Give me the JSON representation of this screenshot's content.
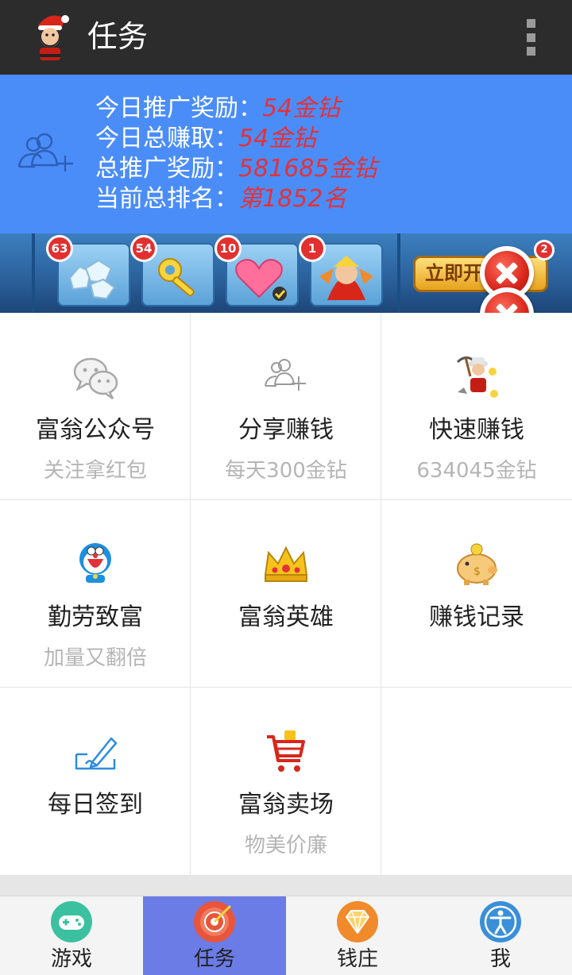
{
  "appbar": {
    "title": "任务",
    "avatar_icon": "santa-avatar-icon",
    "menu_icon": "overflow-menu-icon"
  },
  "stats": {
    "icon": "add-friends-icon",
    "lines": [
      {
        "label": "今日推广奖励：",
        "value": "54金钻"
      },
      {
        "label": "今日总赚取：",
        "value": "54金钻"
      },
      {
        "label": "总推广奖励：",
        "value": "581685金钻"
      },
      {
        "label": "当前总排名：",
        "value": "第1852名"
      }
    ]
  },
  "banner": {
    "badges": [
      "63",
      "54",
      "10",
      "1"
    ],
    "cta_text": "立即开",
    "cta_badge": "2"
  },
  "grid": [
    {
      "name": "富翁公众号",
      "sub": "关注拿红包",
      "icon": "wechat-icon"
    },
    {
      "name": "分享赚钱",
      "sub": "每天300金钻",
      "icon": "share-people-icon"
    },
    {
      "name": "快速赚钱",
      "sub": "634045金钻",
      "icon": "miner-icon"
    },
    {
      "name": "勤劳致富",
      "sub": "加量又翻倍",
      "icon": "doraemon-icon"
    },
    {
      "name": "富翁英雄",
      "sub": "",
      "icon": "crown-icon"
    },
    {
      "name": "赚钱记录",
      "sub": "",
      "icon": "piggy-bank-icon"
    },
    {
      "name": "每日签到",
      "sub": "",
      "icon": "sign-in-icon"
    },
    {
      "name": "富翁卖场",
      "sub": "物美价廉",
      "icon": "shopping-cart-icon"
    }
  ],
  "bottom_nav": [
    {
      "label": "游戏",
      "icon": "gamepad-icon",
      "color": "#3cc1a0",
      "active": false
    },
    {
      "label": "任务",
      "icon": "target-icon",
      "color": "#e8553b",
      "active": true
    },
    {
      "label": "钱庄",
      "icon": "diamond-icon",
      "color": "#f08a2a",
      "active": false
    },
    {
      "label": "我",
      "icon": "accessibility-icon",
      "color": "#3a8fd8",
      "active": false
    }
  ],
  "colors": {
    "appbar_bg": "#2c2c2c",
    "stats_bg": "#4b8df8",
    "value_red": "#e2323a",
    "active_tab": "#6b7ce6"
  }
}
